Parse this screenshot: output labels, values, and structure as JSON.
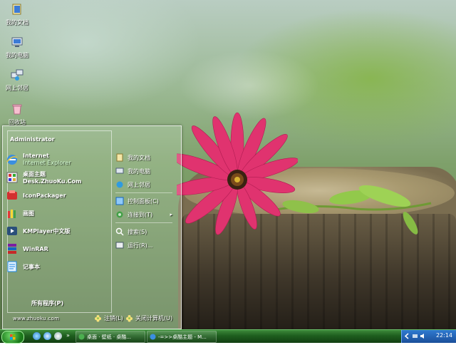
{
  "desktop": {
    "icons": [
      {
        "label": "我的文档",
        "icon": "my-documents-icon"
      },
      {
        "label": "我的电脑",
        "icon": "my-computer-icon"
      },
      {
        "label": "网上邻居",
        "icon": "network-places-icon"
      },
      {
        "label": "回收站",
        "icon": "recycle-bin-icon"
      }
    ]
  },
  "start_menu": {
    "user": "Administrator",
    "left_items": [
      {
        "label": "Internet",
        "sub": "Internet Explorer",
        "icon": "internet-explorer-icon"
      },
      {
        "label": "桌面主题Desk.ZhuoKu.Com",
        "icon": "theme-app-icon"
      },
      {
        "label": "IconPackager",
        "icon": "iconpackager-icon"
      },
      {
        "label": "画图",
        "icon": "paint-icon"
      },
      {
        "label": "KMPlayer中文版",
        "icon": "kmplayer-icon"
      },
      {
        "label": "WinRAR",
        "icon": "winrar-icon"
      },
      {
        "label": "记事本",
        "icon": "notepad-icon"
      }
    ],
    "all_programs": "所有程序(P)",
    "right_items": [
      {
        "label": "我的文档",
        "icon": "my-documents-icon"
      },
      {
        "label": "我的电脑",
        "icon": "my-computer-icon"
      },
      {
        "label": "网上邻居",
        "icon": "network-places-icon"
      },
      {
        "label": "控制面板(C)",
        "icon": "control-panel-icon"
      },
      {
        "label": "连接到(T)",
        "icon": "connect-to-icon",
        "submenu": "▸"
      },
      {
        "label": "搜索(S)",
        "icon": "search-icon"
      },
      {
        "label": "运行(R)...",
        "icon": "run-icon"
      }
    ],
    "url": "www.zhuoku.com",
    "logoff": "注销(L)",
    "shutdown": "关闭计算机(U)"
  },
  "taskbar": {
    "tasks": [
      {
        "label": "桌面 · 壁纸 · 桌酷...",
        "icon": "browser-icon"
      },
      {
        "label": "-=>>桌酷主题 - M...",
        "icon": "ie-window-icon"
      }
    ],
    "clock": "22:14"
  },
  "colors": {
    "taskbar_green": "#1e5e1e",
    "tray_blue": "#1b4f9a",
    "flower_pink": "#e0336f"
  }
}
